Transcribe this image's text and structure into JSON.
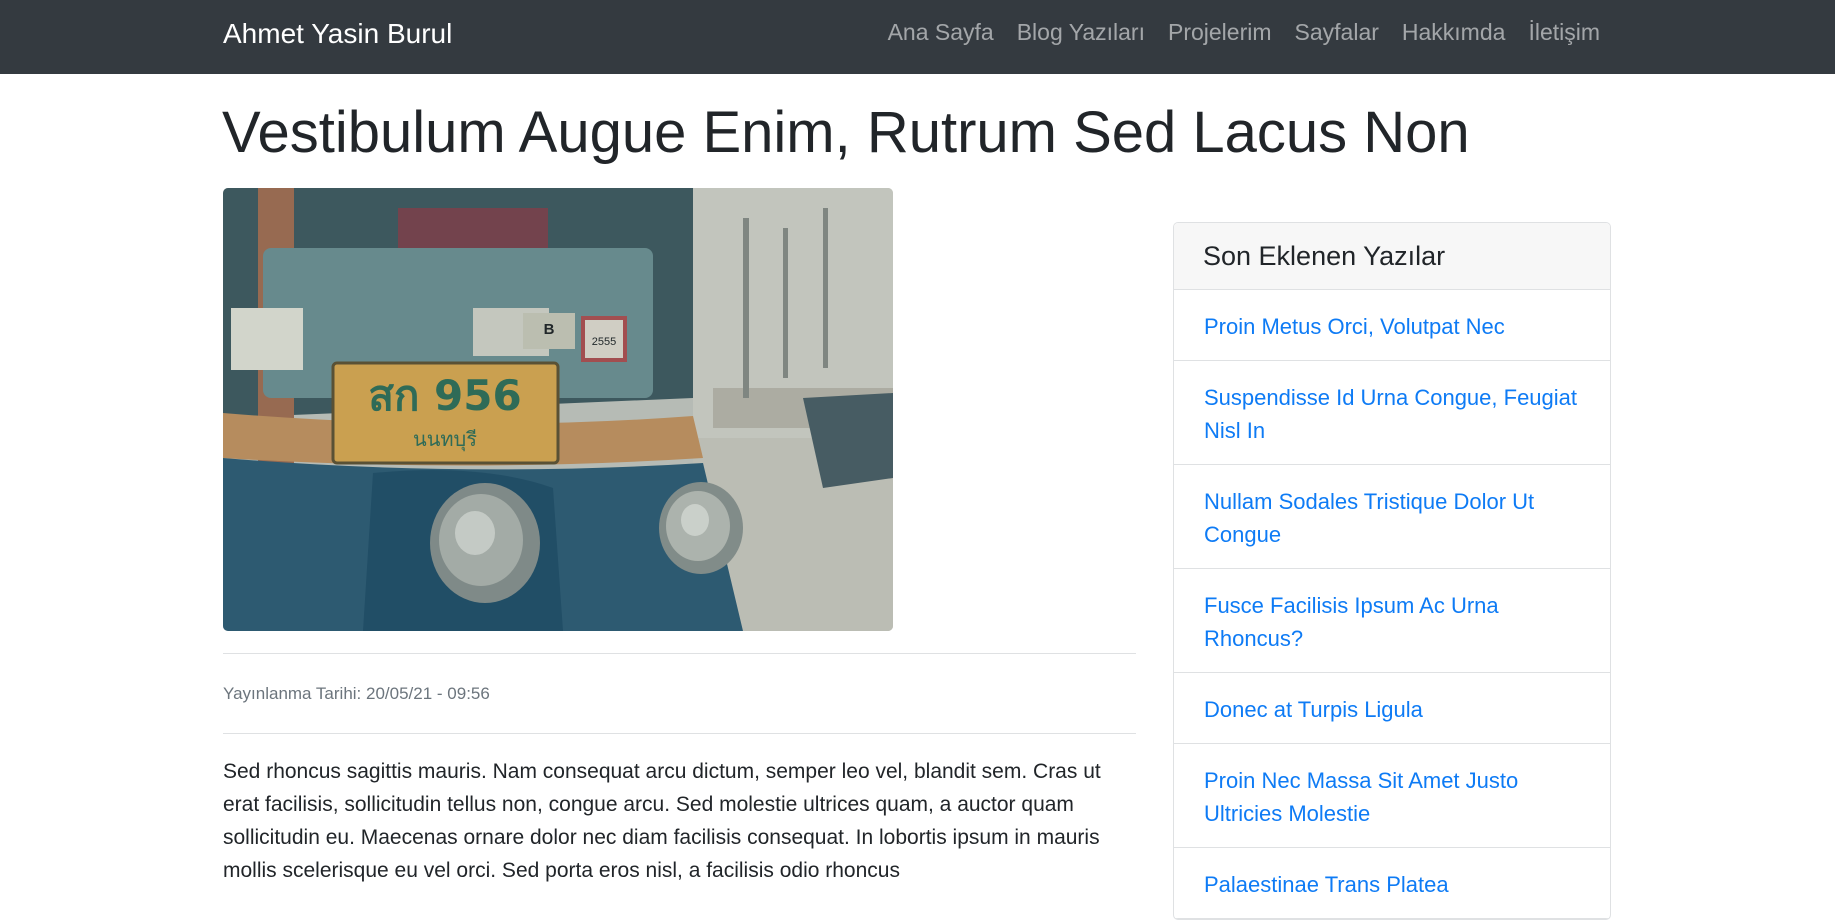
{
  "navbar": {
    "brand": "Ahmet Yasin Burul",
    "links": [
      "Ana Sayfa",
      "Blog Yazıları",
      "Projelerim",
      "Sayfalar",
      "Hakkımda",
      "İletişim"
    ]
  },
  "post": {
    "title": "Vestibulum Augue Enim, Rutrum Sed Lacus Non",
    "image": {
      "license_plate_top": "สก 956",
      "license_plate_bottom": "นนทบุรี",
      "sticker_number": "2555",
      "sticker_letter": "B"
    },
    "date_label": "Yayınlanma Tarihi: 20/05/21 - 09:56",
    "body": "Sed rhoncus sagittis mauris. Nam consequat arcu dictum, semper leo vel, blandit sem. Cras ut erat facilisis, sollicitudin tellus non, congue arcu. Sed molestie ultrices quam, a auctor quam sollicitudin eu. Maecenas ornare dolor nec diam facilisis consequat. In lobortis ipsum in mauris mollis scelerisque eu vel orci. Sed porta eros nisl, a facilisis odio rhoncus"
  },
  "sidebar": {
    "title": "Son Eklenen Yazılar",
    "items": [
      "Proin Metus Orci, Volutpat Nec",
      "Suspendisse Id Urna Congue, Feugiat Nisl In",
      "Nullam Sodales Tristique Dolor Ut Congue",
      "Fusce Facilisis Ipsum Ac Urna Rhoncus?",
      "Donec at Turpis Ligula",
      "Proin Nec Massa Sit Amet Justo Ultricies Molestie",
      "Palaestinae Trans Platea"
    ]
  },
  "colors": {
    "navbar_bg": "#343a40",
    "link": "#0e7bf5",
    "muted": "#6c757d"
  }
}
